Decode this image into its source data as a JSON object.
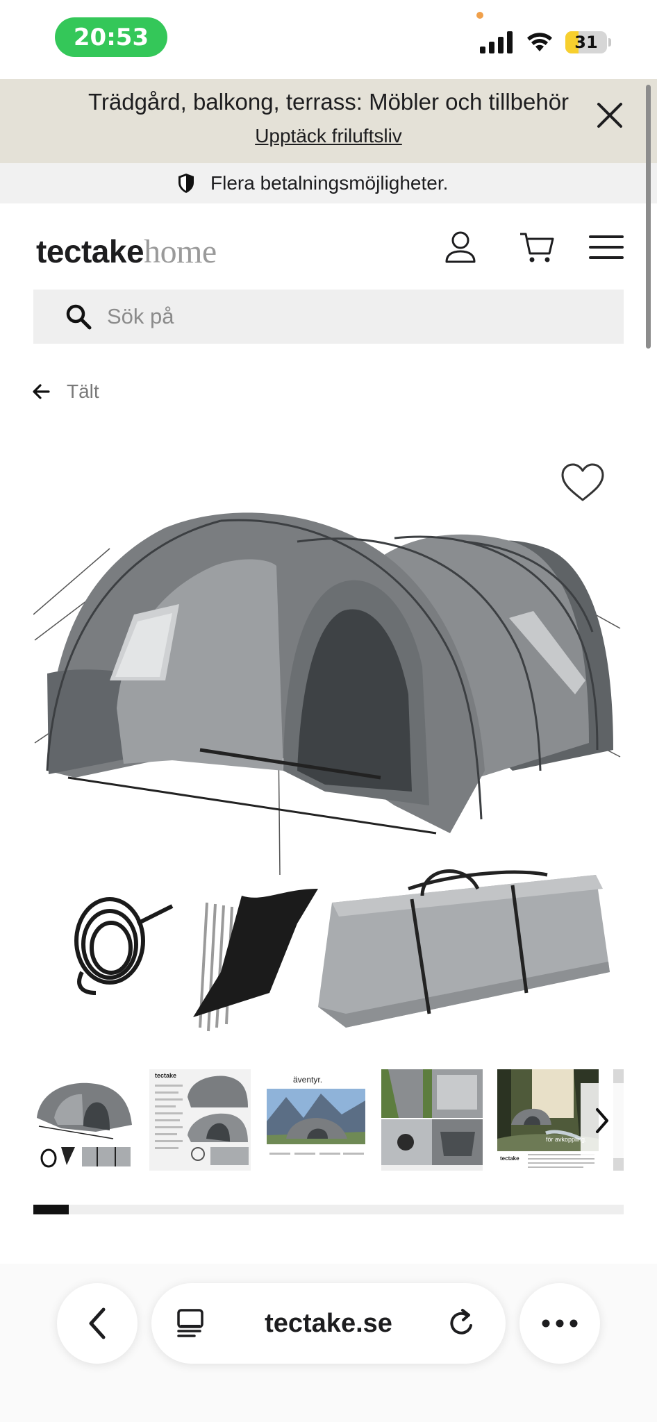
{
  "status_bar": {
    "time": "20:53",
    "battery_level": "31",
    "battery_fraction": 0.31,
    "icons": [
      "signal-icon",
      "wifi-icon",
      "battery-icon"
    ]
  },
  "promo_banner": {
    "title": "Trädgård, balkong, terrass: Möbler och tillbehör",
    "link": "Upptäck friluftsliv",
    "close_icon": "close-icon"
  },
  "payment_strip": {
    "icon": "shield-icon",
    "text": "Flera betalningsmöjligheter."
  },
  "header": {
    "logo_bold": "tectake",
    "logo_light": "home",
    "icons": [
      "account-icon",
      "cart-icon",
      "menu-icon"
    ]
  },
  "search": {
    "placeholder": "Sök på",
    "icon": "search-icon"
  },
  "breadcrumb": {
    "icon": "arrow-left-icon",
    "label": "Tält"
  },
  "gallery": {
    "wishlist_icon": "heart-icon",
    "thumbnail_count": 6,
    "thumbnails": [
      {
        "texts": []
      },
      {
        "texts": [
          "tectake"
        ]
      },
      {
        "texts": [
          "äventyr."
        ]
      },
      {
        "texts": []
      },
      {
        "texts": [
          "för avkoppling.",
          "tectake"
        ]
      },
      {
        "texts": []
      }
    ],
    "next_icon": "chevron-right-icon",
    "progress_fraction": 0.06
  },
  "browser": {
    "url": "tectake.se",
    "icons": [
      "back-icon",
      "tabs-icon",
      "reload-icon",
      "more-icon"
    ]
  },
  "colors": {
    "time_pill": "#34c759",
    "promo_bg": "#e4e1d7",
    "tent_dark": "#6a6d70",
    "tent_light": "#a5a8ab"
  }
}
